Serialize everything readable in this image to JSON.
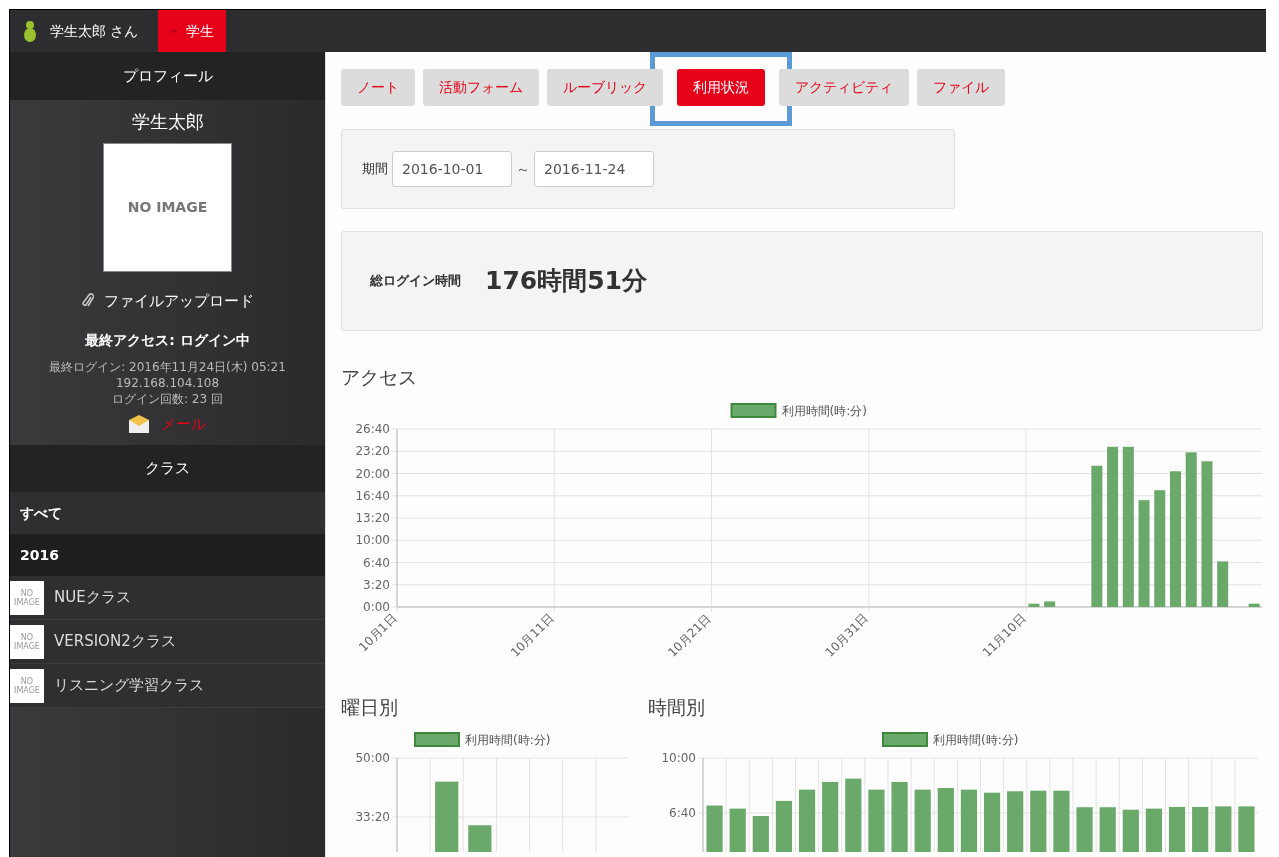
{
  "topbar": {
    "user": "学生太郎 さん",
    "role": "学生"
  },
  "sidebar": {
    "profile_header": "プロフィール",
    "name": "学生太郎",
    "avatar_text": "NO IMAGE",
    "upload": "ファイルアップロード",
    "last_access": "最終アクセス: ログイン中",
    "last_login": "最終ログイン: 2016年11月24日(木) 05:21",
    "ip": "192.168.104.108",
    "login_count": "ログイン回数: 23 回",
    "mail": "メール",
    "class_header": "クラス",
    "groups": [
      {
        "label": "すべて",
        "kind": "filter"
      },
      {
        "label": "2016",
        "kind": "year"
      }
    ],
    "classes": [
      {
        "name": "NUEクラス",
        "thumb": "NO IMAGE"
      },
      {
        "name": "VERSION2クラス",
        "thumb": "NO IMAGE"
      },
      {
        "name": "リスニング学習クラス",
        "thumb": "NO IMAGE"
      }
    ]
  },
  "tabs": [
    {
      "label": "ノート",
      "selected": false,
      "highlighted": false
    },
    {
      "label": "活動フォーム",
      "selected": false,
      "highlighted": false
    },
    {
      "label": "ルーブリック",
      "selected": false,
      "highlighted": false
    },
    {
      "label": "利用状況",
      "selected": true,
      "highlighted": true
    },
    {
      "label": "アクティビティ",
      "selected": false,
      "highlighted": false
    },
    {
      "label": "ファイル",
      "selected": false,
      "highlighted": false
    }
  ],
  "period": {
    "label": "期間",
    "from": "2016-10-01",
    "separator": "～",
    "to": "2016-11-24"
  },
  "total": {
    "label": "総ログイン時間",
    "value": "176時間51分"
  },
  "access": {
    "title": "アクセス",
    "chart_data": {
      "type": "bar",
      "grid": true,
      "categories": [
        "10月1日",
        null,
        null,
        null,
        null,
        null,
        null,
        null,
        null,
        null,
        "10月11日",
        null,
        null,
        null,
        null,
        null,
        null,
        null,
        null,
        null,
        "10月21日",
        null,
        null,
        null,
        null,
        null,
        null,
        null,
        null,
        null,
        "10月31日",
        null,
        null,
        null,
        null,
        null,
        null,
        null,
        null,
        null,
        "11月10日",
        null,
        null,
        null,
        null,
        null,
        null,
        null,
        null,
        null,
        null,
        null,
        null,
        null,
        null
      ],
      "series": [
        {
          "name": "利用時間(時:分)",
          "color": "#6aa96a",
          "values": [
            0,
            0,
            0,
            0,
            0,
            0,
            0,
            0,
            0,
            0,
            0,
            0,
            0,
            0,
            0,
            0,
            0,
            0,
            0,
            0,
            0,
            0,
            0,
            0,
            0,
            0,
            0,
            0,
            0,
            0,
            0,
            0,
            0,
            0,
            0,
            0,
            0,
            0,
            0,
            0,
            30,
            50,
            0,
            0,
            1270,
            1440,
            1440,
            960,
            1050,
            1220,
            1390,
            1310,
            410,
            0,
            30
          ]
        }
      ],
      "ylim": [
        0,
        1600
      ],
      "yticks": [
        {
          "value": 0,
          "label": "0:00"
        },
        {
          "value": 200,
          "label": "3:20"
        },
        {
          "value": 400,
          "label": "6:40"
        },
        {
          "value": 600,
          "label": "10:00"
        },
        {
          "value": 800,
          "label": "13:20"
        },
        {
          "value": 1000,
          "label": "16:40"
        },
        {
          "value": 1200,
          "label": "20:00"
        },
        {
          "value": 1400,
          "label": "23:20"
        },
        {
          "value": 1600,
          "label": "26:40"
        }
      ]
    }
  },
  "weekday": {
    "title": "曜日別",
    "chart_data": {
      "type": "bar",
      "grid": true,
      "series": [
        {
          "name": "利用時間(時:分)",
          "color": "#6aa96a",
          "values": [
            null,
            2600,
            1860,
            null,
            null,
            null,
            null
          ]
        }
      ],
      "ylim": [
        0,
        3000
      ],
      "yticks": [
        {
          "value": 2000,
          "label": "33:20"
        },
        {
          "value": 3000,
          "label": "50:00"
        }
      ]
    }
  },
  "hourly": {
    "title": "時間別",
    "chart_data": {
      "type": "bar",
      "grid": true,
      "series": [
        {
          "name": "利用時間(時:分)",
          "color": "#6aa96a",
          "values": [
            427,
            416,
            389,
            444,
            485,
            513,
            525,
            485,
            513,
            485,
            491,
            485,
            474,
            479,
            481,
            481,
            421,
            421,
            412,
            416,
            422,
            422,
            424,
            424
          ]
        }
      ],
      "ylim": [
        0,
        600
      ],
      "yticks": [
        {
          "value": 400,
          "label": "6:40"
        },
        {
          "value": 600,
          "label": "10:00"
        }
      ]
    }
  }
}
